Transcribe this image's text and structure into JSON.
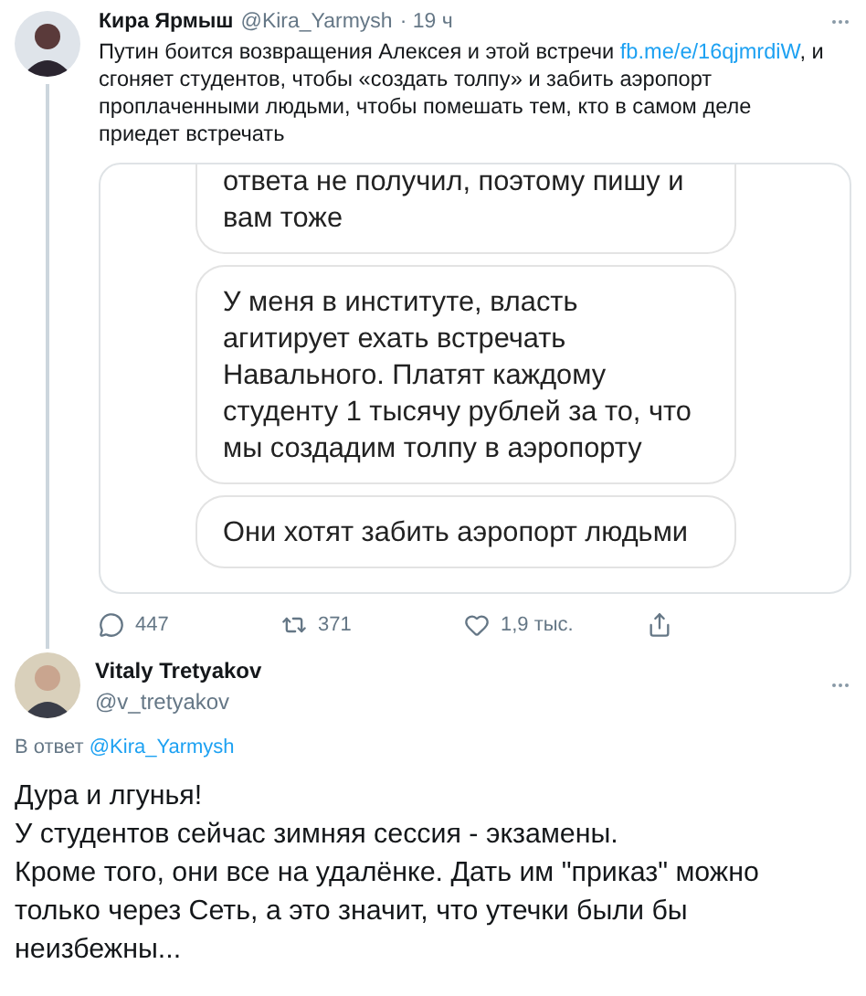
{
  "tweet": {
    "name": "Кира Ярмыш",
    "handle": "@Kira_Yarmysh",
    "time": "· 19 ч",
    "text": "Путин боится возвращения Алексея и этой встречи ",
    "link": "fb.me/e/16qjmrdiW",
    "text_after": ", и сгоняет студентов, чтобы «создать толпу» и забить аэропорт проплаченными людьми, чтобы помешать тем, кто в самом деле приедет встречать",
    "image_messages": [
      "ответа не получил, поэтому пишу и вам тоже",
      "У меня в институте, власть агитирует ехать встречать Навального. Платят каждому студенту 1 тысячу рублей за то, что мы создадим толпу в аэропорту",
      "Они хотят забить аэропорт людьми"
    ],
    "actions": [
      {
        "kind": "reply",
        "count": "447"
      },
      {
        "kind": "retweet",
        "count": "371"
      },
      {
        "kind": "like",
        "count": "1,9 тыс."
      },
      {
        "kind": "share"
      }
    ]
  },
  "reply": {
    "name": "Vitaly Tretyakov",
    "handle": "@v_tretyakov",
    "reply_prefix": "В ответ ",
    "reply_to": "@Kira_Yarmysh",
    "paragraphs": [
      "Дура и лгунья!",
      "У студентов сейчас зимняя сессия - экзамены.",
      "Кроме того, они все на удалёнке. Дать им \"приказ\" можно только через Сеть, а это значит, что утечки были бы неизбежны..."
    ]
  }
}
